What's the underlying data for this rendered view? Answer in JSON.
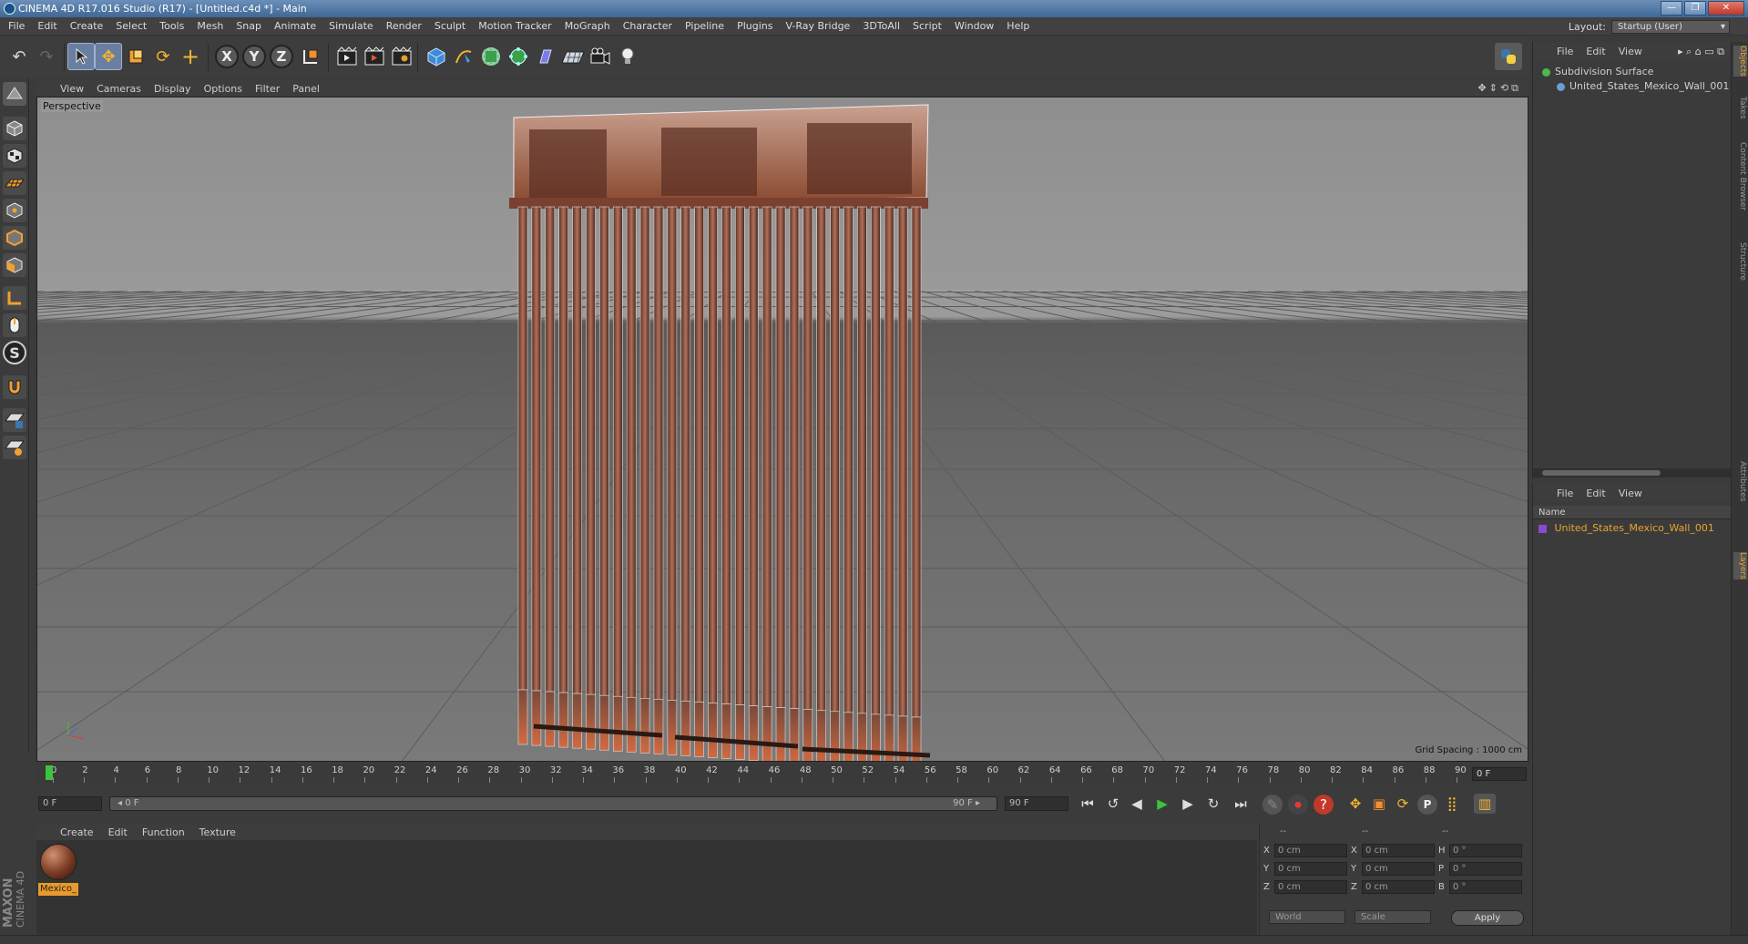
{
  "window": {
    "title": "CINEMA 4D R17.016 Studio (R17) - [Untitled.c4d *] - Main",
    "buttons": [
      "—",
      "❐",
      "✕"
    ]
  },
  "menubar": {
    "items": [
      "File",
      "Edit",
      "Create",
      "Select",
      "Tools",
      "Mesh",
      "Snap",
      "Animate",
      "Simulate",
      "Render",
      "Sculpt",
      "Motion Tracker",
      "MoGraph",
      "Character",
      "Pipeline",
      "Plugins",
      "V-Ray Bridge",
      "3DToAll",
      "Script",
      "Window",
      "Help"
    ],
    "layout_label": "Layout:",
    "layout_value": "Startup (User)"
  },
  "toolbar": {
    "icons": [
      "undo-icon",
      "redo-icon",
      "select-icon",
      "move-icon",
      "scale-icon",
      "rotate-icon",
      "add-icon",
      "x-axis",
      "y-axis",
      "z-axis",
      "coordinate-system-icon",
      "render-view-icon",
      "render-picture-viewer-icon",
      "edit-render-settings-icon",
      "cube-icon",
      "pen-icon",
      "subdivide-icon",
      "array-icon",
      "deformer-icon",
      "floor-icon",
      "camera-icon",
      "light-icon",
      "python-icon"
    ],
    "axis_labels": [
      "X",
      "Y",
      "Z"
    ]
  },
  "lefttools": {
    "icons": [
      "model-mode-icon",
      "object-mode-icon",
      "texture-mode-icon",
      "workplane-icon",
      "points-mode-icon",
      "edges-mode-icon",
      "polygons-mode-icon",
      "axis-mode-icon",
      "tweak-mode-icon",
      "solo-icon",
      "magnet-icon",
      "snap-lock-icon",
      "snap-settings-icon"
    ],
    "solo_glyph": "S"
  },
  "branding": {
    "maxon": "MAXON",
    "cinema": "CINEMA 4D"
  },
  "viewport": {
    "menu": [
      "View",
      "Cameras",
      "Display",
      "Options",
      "Filter",
      "Panel"
    ],
    "label": "Perspective",
    "grid_spacing": "Grid Spacing : 1000 cm"
  },
  "timeline": {
    "ticks": [
      "0",
      "2",
      "4",
      "6",
      "8",
      "10",
      "12",
      "14",
      "16",
      "18",
      "20",
      "22",
      "24",
      "26",
      "28",
      "30",
      "32",
      "34",
      "36",
      "38",
      "40",
      "42",
      "44",
      "46",
      "48",
      "50",
      "52",
      "54",
      "56",
      "58",
      "60",
      "62",
      "64",
      "66",
      "68",
      "70",
      "72",
      "74",
      "76",
      "78",
      "80",
      "82",
      "84",
      "86",
      "88",
      "90"
    ],
    "end_field": "0 F"
  },
  "transport": {
    "start_field": "0 F",
    "range_start": "◂ 0 F",
    "range_end": "90 F ▸",
    "end_field": "90 F"
  },
  "material_manager": {
    "menu": [
      "Create",
      "Edit",
      "Function",
      "Texture"
    ],
    "material_name": "Mexico_"
  },
  "coordinates": {
    "headers": [
      "--",
      "--",
      "--"
    ],
    "rows": [
      {
        "l1": "X",
        "v1": "0 cm",
        "l2": "X",
        "v2": "0 cm",
        "l3": "H",
        "v3": "0 °"
      },
      {
        "l1": "Y",
        "v1": "0 cm",
        "l2": "Y",
        "v2": "0 cm",
        "l3": "P",
        "v3": "0 °"
      },
      {
        "l1": "Z",
        "v1": "0 cm",
        "l2": "Z",
        "v2": "0 cm",
        "l3": "B",
        "v3": "0 °"
      }
    ],
    "space_dropdown": "World",
    "mode_dropdown": "Scale",
    "apply_label": "Apply"
  },
  "object_manager": {
    "menu": [
      "File",
      "Edit",
      "View"
    ],
    "tree": [
      {
        "name": "Subdivision Surface",
        "color": "#4cb84c"
      },
      {
        "name": "United_States_Mexico_Wall_001",
        "color": "#6a9ed8"
      }
    ]
  },
  "layer_manager": {
    "menu": [
      "File",
      "Edit",
      "View"
    ],
    "column": "Name",
    "row": "United_States_Mexico_Wall_001"
  },
  "side_tabs": [
    "Objects",
    "Takes",
    "Content Browser",
    "Structure",
    "Attributes",
    "Layers"
  ],
  "colors": {
    "accent_orange": "#e89a2c",
    "active_tool": "#6a7ea0",
    "play_green": "#3ec23e",
    "wall_rust": "#b85a3a"
  }
}
